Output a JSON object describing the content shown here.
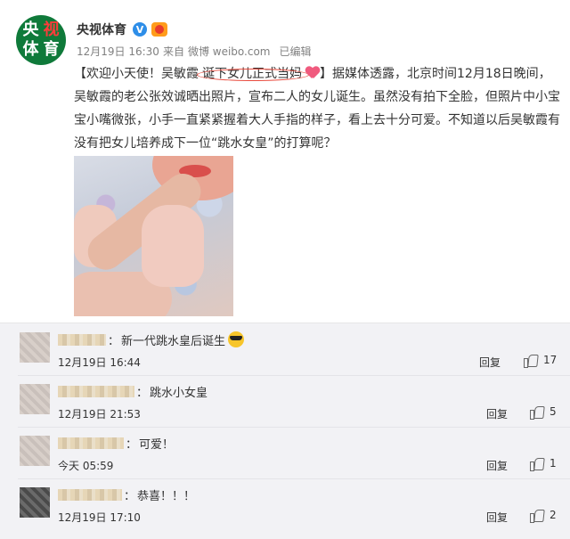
{
  "post": {
    "author_name": "央视体育",
    "avatar_text": [
      "央",
      "视",
      "体",
      "育"
    ],
    "verified_mark": "V",
    "date": "12月19日 16:30",
    "from_label": "来自",
    "source": "微博 weibo.com",
    "edited_label": "已编辑",
    "title_open": "【欢迎小天使！吴敏霞",
    "title_highlight": "诞下女儿正式当妈",
    "title_close": "】",
    "body": "据媒体透露，北京时间12月18日晚间，吴敏霞的老公张效诚晒出照片，宣布二人的女儿诞生。虽然没有拍下全脸，但照片中小宝宝小嘴微张，小手一直紧紧握着大人手指的样子，看上去十分可爱。不知道以后吴敏霞有没有把女儿培养成下一位“跳水女皇”的打算呢？",
    "colors": {
      "verified": "#2e8ee8",
      "highlight_circle": "#e94c3f",
      "avatar_bg": "#0f7a3a"
    }
  },
  "comments": [
    {
      "text": "新一代跳水皇后诞生",
      "time": "12月19日 16:44",
      "reply_label": "回复",
      "likes": "17",
      "emoji": "sunglasses-icon"
    },
    {
      "text": "跳水小女皇",
      "time": "12月19日 21:53",
      "reply_label": "回复",
      "likes": "5"
    },
    {
      "text": "可爱！",
      "time": "今天 05:59",
      "reply_label": "回复",
      "likes": "1"
    },
    {
      "text": "恭喜！！！",
      "time": "12月19日 17:10",
      "reply_label": "回复",
      "likes": "2"
    }
  ]
}
